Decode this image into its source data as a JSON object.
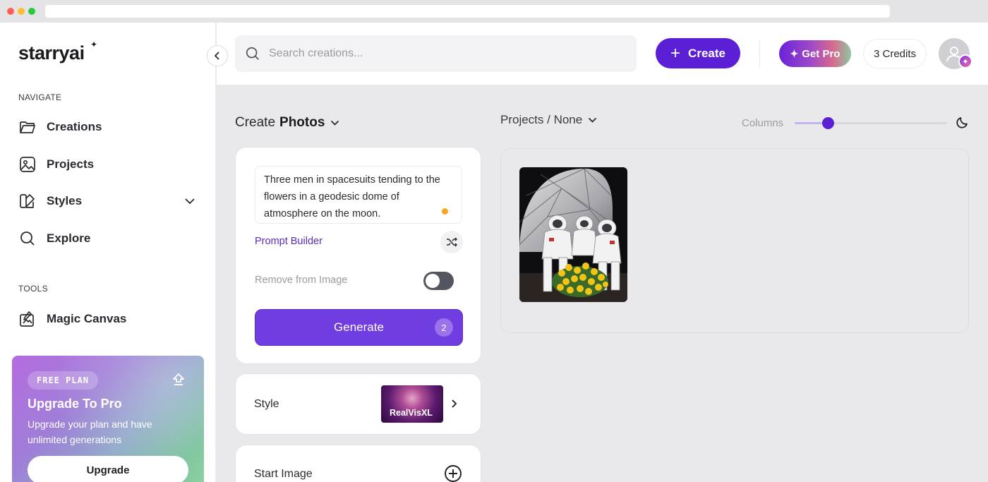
{
  "brand": {
    "name": "starryai",
    "star": "✦"
  },
  "sidebar": {
    "navigate_label": "NAVIGATE",
    "tools_label": "TOOLS",
    "items": [
      {
        "label": "Creations",
        "icon": "folder-icon"
      },
      {
        "label": "Projects",
        "icon": "image-frame-icon"
      },
      {
        "label": "Styles",
        "icon": "palette-icon"
      },
      {
        "label": "Explore",
        "icon": "search-icon"
      }
    ],
    "tools": [
      {
        "label": "Magic Canvas",
        "icon": "canvas-icon"
      }
    ],
    "promo": {
      "badge": "FREE PLAN",
      "title": "Upgrade To Pro",
      "description": "Upgrade your plan and have unlimited generations",
      "button": "Upgrade"
    }
  },
  "header": {
    "search_placeholder": "Search creations...",
    "create_label": "Create",
    "get_pro_label": "Get Pro",
    "credits_label": "3 Credits"
  },
  "create_panel": {
    "title_prefix": "Create",
    "title_mode": "Photos",
    "prompt_text": "Three men in spacesuits tending to the flowers in a geodesic dome of atmosphere on the moon.",
    "prompt_builder_label": "Prompt Builder",
    "remove_from_image_label": "Remove from Image",
    "remove_from_image_on": false,
    "generate_label": "Generate",
    "generate_count": "2",
    "style_label": "Style",
    "style_value": "RealVisXL",
    "start_image_label": "Start Image"
  },
  "gallery": {
    "breadcrumb": "Projects / None",
    "columns_label": "Columns",
    "columns_value_fraction": 0.22
  },
  "colors": {
    "accent": "#5b1fd6",
    "generate": "#6f3de0",
    "prompt_builder": "#5b2bb8",
    "status_dot": "#f5a623"
  }
}
